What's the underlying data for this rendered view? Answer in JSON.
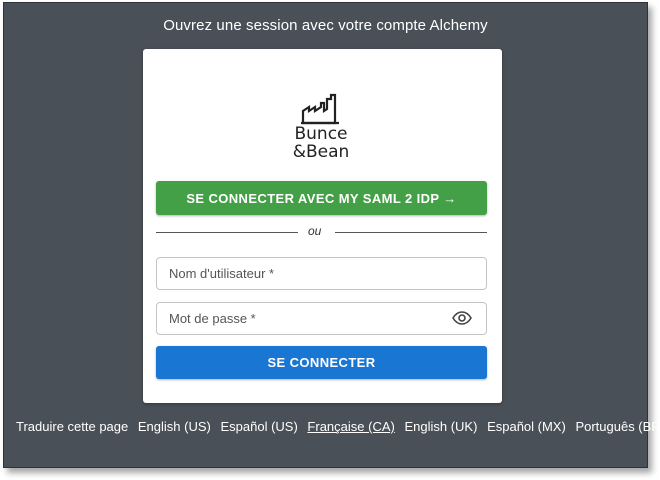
{
  "header": {
    "title": "Ouvrez une session avec votre compte Alchemy"
  },
  "logo": {
    "line1": "Bunce",
    "line2": "&Bean",
    "icon": "factory-icon"
  },
  "login": {
    "sso_button": "SE CONNECTER AVEC MY SAML 2 IDP →",
    "divider": "ou",
    "username_placeholder": "Nom d'utilisateur *",
    "password_placeholder": "Mot de passe *",
    "submit_button": "SE CONNECTER"
  },
  "languages": {
    "label": "Traduire cette page",
    "items": [
      "English (US)",
      "Español (US)",
      "Française (CA)",
      "English (UK)",
      "Español (MX)",
      "Português (BR)"
    ],
    "active": "Française (CA)"
  },
  "colors": {
    "background": "#4a5057",
    "sso_button": "#43a047",
    "submit_button": "#1976d2"
  }
}
